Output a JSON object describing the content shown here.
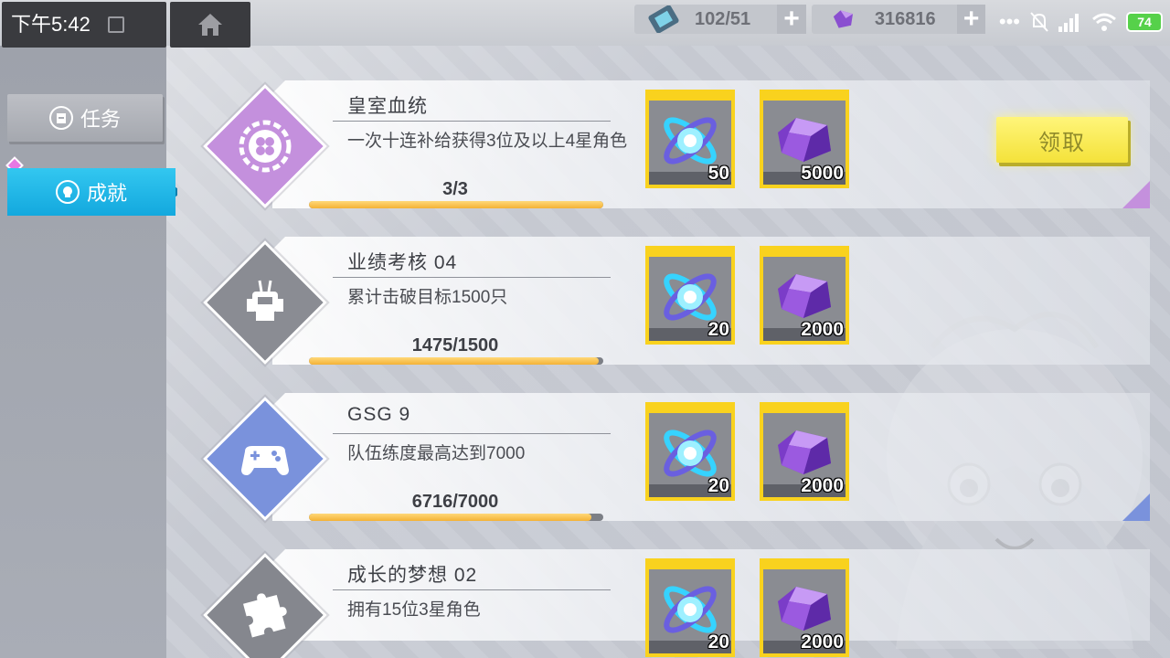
{
  "statusbar": {
    "time": "下午5:42",
    "battery": "74"
  },
  "resources": [
    {
      "icon": "hourglass-icon",
      "value": "102/51"
    },
    {
      "icon": "crystal-icon",
      "value": "316816"
    }
  ],
  "tabs": [
    {
      "label": "任务",
      "active": false
    },
    {
      "label": "成就",
      "active": true
    }
  ],
  "claim_label": "领取",
  "colors": {
    "accent": "#1eb4e6",
    "claim": "#f4e23a",
    "reward_frame": "#f9d21e",
    "progress": "#f4b236"
  },
  "achievements": [
    {
      "title": "皇室血统",
      "desc": "一次十连补给获得3位及以上4星角色",
      "progress": "3/3",
      "ratio": 1.0,
      "icon": "clover-icon",
      "diamond_color": "#c490dd",
      "rewards": [
        {
          "icon": "ring-crystal-icon",
          "qty": "50"
        },
        {
          "icon": "purple-gem-icon",
          "qty": "5000"
        }
      ],
      "claimable": true
    },
    {
      "title": "业绩考核 04",
      "desc": "累计击破目标1500只",
      "progress": "1475/1500",
      "ratio": 0.983,
      "icon": "robot-icon",
      "diamond_color": "#8a8c93",
      "rewards": [
        {
          "icon": "ring-crystal-icon",
          "qty": "20"
        },
        {
          "icon": "purple-gem-icon",
          "qty": "2000"
        }
      ],
      "claimable": false
    },
    {
      "title": "GSG 9",
      "desc": "队伍练度最高达到7000",
      "progress": "6716/7000",
      "ratio": 0.959,
      "icon": "gamepad-icon",
      "diamond_color": "#7a92dc",
      "rewards": [
        {
          "icon": "ring-crystal-icon",
          "qty": "20"
        },
        {
          "icon": "purple-gem-icon",
          "qty": "2000"
        }
      ],
      "claimable": false
    },
    {
      "title": "成长的梦想 02",
      "desc": "拥有15位3星角色",
      "progress": "",
      "ratio": 0,
      "icon": "puzzle-icon",
      "diamond_color": "#85878e",
      "rewards": [
        {
          "icon": "ring-crystal-icon",
          "qty": "20"
        },
        {
          "icon": "purple-gem-icon",
          "qty": "2000"
        }
      ],
      "claimable": false
    }
  ]
}
